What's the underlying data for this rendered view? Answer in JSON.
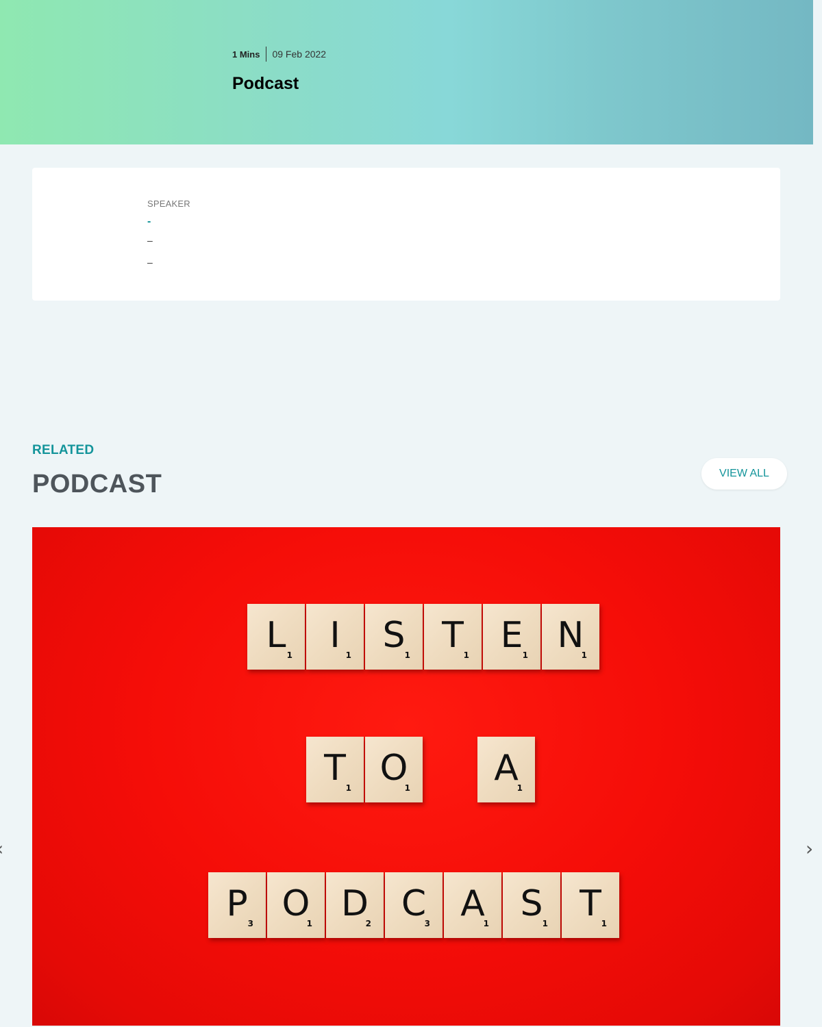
{
  "hero": {
    "duration": "1 Mins",
    "date": "09 Feb 2022",
    "title": "Podcast"
  },
  "speaker": {
    "label": "SPEAKER",
    "name": "-",
    "line1": "–",
    "line2": "–"
  },
  "related": {
    "eyebrow": "RELATED",
    "title": "PODCAST",
    "view_all_label": "VIEW ALL"
  },
  "card": {
    "image_alt": "Scrabble tiles spelling LISTEN TO A PODCAST on red background",
    "tiles_row1": [
      {
        "letter": "L",
        "score": "1"
      },
      {
        "letter": "I",
        "score": "1"
      },
      {
        "letter": "S",
        "score": "1"
      },
      {
        "letter": "T",
        "score": "1"
      },
      {
        "letter": "E",
        "score": "1"
      },
      {
        "letter": "N",
        "score": "1"
      }
    ],
    "tiles_row2": [
      {
        "letter": "T",
        "score": "1"
      },
      {
        "letter": "O",
        "score": "1"
      },
      {
        "letter": "A",
        "score": "1"
      }
    ],
    "tiles_row3": [
      {
        "letter": "P",
        "score": "3"
      },
      {
        "letter": "O",
        "score": "1"
      },
      {
        "letter": "D",
        "score": "2"
      },
      {
        "letter": "C",
        "score": "3"
      },
      {
        "letter": "A",
        "score": "1"
      },
      {
        "letter": "S",
        "score": "1"
      },
      {
        "letter": "T",
        "score": "1"
      }
    ]
  },
  "carousel": {
    "prev_icon": "chevron-left-icon",
    "next_icon": "chevron-right-icon"
  },
  "colors": {
    "accent": "#13949a",
    "hero_gradient_start": "#8fe8b1",
    "hero_gradient_end": "#74b8c3",
    "page_bg": "#eef5f7",
    "image_red": "#f50d08"
  }
}
